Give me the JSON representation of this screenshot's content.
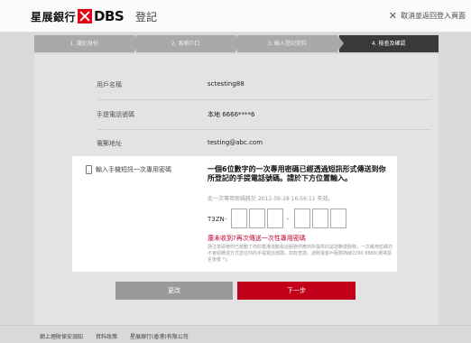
{
  "header": {
    "logo_cn": "星展銀行",
    "logo_en": "DBS",
    "title": "登記",
    "cancel_label": "取消並返回登入頁面"
  },
  "steps": [
    {
      "label": "1. 識別身份"
    },
    {
      "label": "2. 客賬戶口"
    },
    {
      "label": "3. 輸入登記資料"
    },
    {
      "label": "4. 檢查及確認"
    }
  ],
  "info": {
    "username_label": "用戶名稱",
    "username_value": "sctesting88",
    "mobile_label": "手提電話號碼",
    "mobile_value": "本地 6666****6",
    "email_label": "電郵地址",
    "email_value": "testing@abc.com"
  },
  "otp": {
    "label": "輸入手機短訊一次專用密碼",
    "instruction": "一個6位數字的一次專用密碼已經透過短訊形式傳送到你所登記的手提電話號碼。請於下方位置輸入。",
    "expiry": "此一次專用密碼將於 2012-09-28 16:56:11 失效。",
    "prefix": "T3ZN",
    "resend": "還未收到?再次傳送一次性專用密碼",
    "note": "請注意即使你已啟動了你的香港流動電話服務供應商所提供的認證轉漫服務，一次專用密碼亦不會經轉漫方式送往你的手提電話號碼。如有查詢，請致電客戶服務熱線2290 8888(選擇語言後按 *)。"
  },
  "buttons": {
    "back": "更改",
    "next": "下一步"
  },
  "footer": {
    "links": [
      "網上理財保安須知",
      "資料政策",
      "星展銀行(香港)有限公司"
    ]
  }
}
